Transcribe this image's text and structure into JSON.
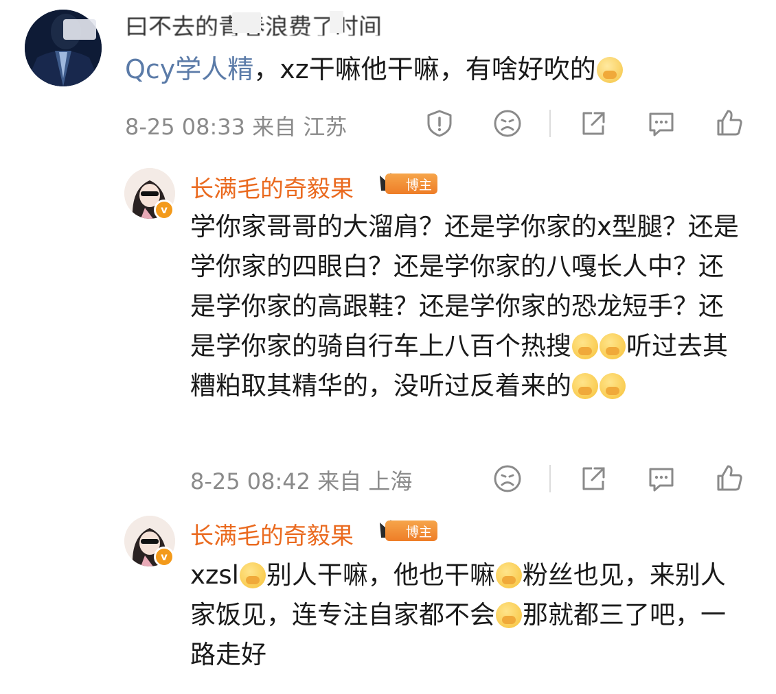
{
  "top_comment": {
    "truncated_text": "曰不去的青春浪费了时间",
    "mention": "Qcy学人精",
    "body": "，xz干嘛他干嘛，有啥好吹的",
    "emoji": "shush-emoji",
    "time": "8-25 08:33",
    "from_label": "来自",
    "location": "江苏"
  },
  "replies": [
    {
      "username": "长满毛的奇毅果",
      "badge": "博主",
      "verified_icon": "v-verified-badge",
      "segments": [
        "学你家哥哥的大溜肩？还是学你家的x型腿？还是学你家的四眼白？还是学你家的八嘎长人中？还是学你家的高跟鞋？还是学你家的恐龙短手？还是学你家的骑自行车上八百个热搜",
        "听过去其糟粕取其精华的，没听过反着来的"
      ],
      "time": "8-25 08:42",
      "from_label": "来自",
      "location": "上海"
    },
    {
      "username": "长满毛的奇毅果",
      "badge": "博主",
      "verified_icon": "v-verified-badge",
      "segments": [
        "xzsl",
        "别人干嘛，他也干嘛",
        "粉丝也见，来别人家饭见，连专注自家都不会",
        "那就都三了吧，一路走好"
      ]
    }
  ],
  "actions": [
    "report-icon",
    "dislike-icon",
    "share-icon",
    "comment-icon",
    "like-icon"
  ],
  "colors": {
    "username": "#ea6a1f",
    "mention": "#5b7ba8",
    "meta": "#8a8a8a",
    "badge": "#ee7d27"
  }
}
